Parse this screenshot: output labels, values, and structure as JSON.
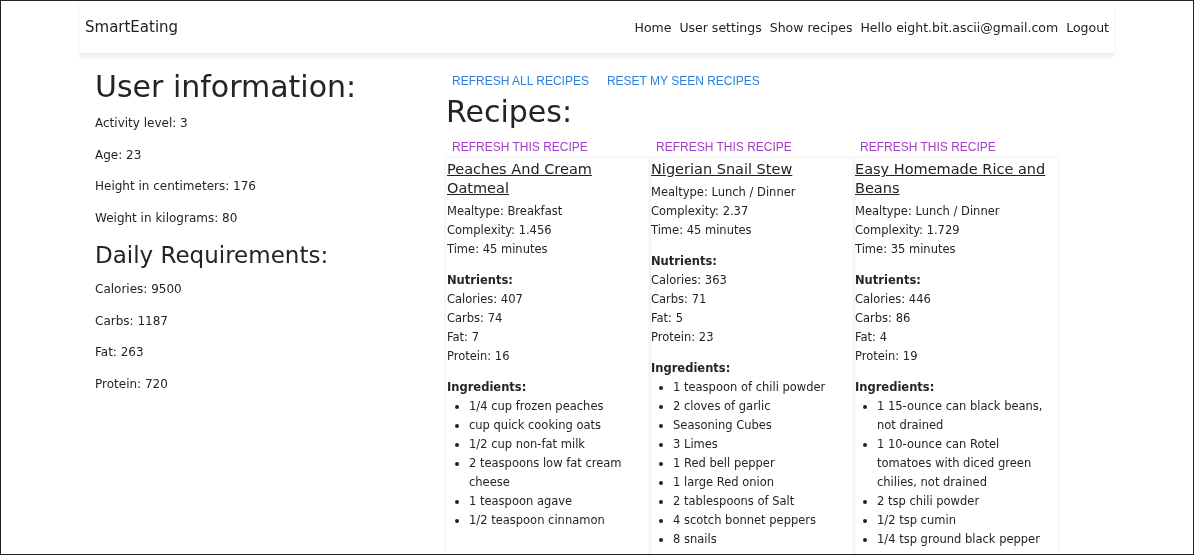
{
  "navbar": {
    "brand": "SmartEating",
    "links": [
      "Home",
      "User settings",
      "Show recipes",
      "Hello eight.bit.ascii@gmail.com",
      "Logout"
    ]
  },
  "user_information": {
    "title": "User information:",
    "fields": [
      "Activity level: 3",
      "Age: 23",
      "Height in centimeters: 176",
      "Weight in kilograms: 80"
    ]
  },
  "daily_requirements": {
    "title": "Daily Requirements:",
    "fields": [
      "Calories: 9500",
      "Carbs: 1187",
      "Fat: 263",
      "Protein: 720"
    ]
  },
  "actions": [
    "REFRESH ALL RECIPES",
    "RESET MY SEEN RECIPES"
  ],
  "recipes_title": "Recipes:",
  "recipes": [
    {
      "refresh": "REFRESH THIS RECIPE",
      "name": "Peaches And Cream Oatmeal",
      "details": [
        "Mealtype: Breakfast",
        "Complexity: 1.456",
        "Time: 45 minutes"
      ],
      "nutrients_title": "Nutrients:",
      "nutrients": [
        "Calories: 407",
        "Carbs: 74",
        "Fat: 7",
        "Protein: 16"
      ],
      "ingredients_title": "Ingredients:",
      "ingredients": [
        "1/4 cup frozen peaches",
        "cup quick cooking oats",
        "1/2 cup non-fat milk",
        "2 teaspoons low fat cream cheese",
        "1 teaspoon agave",
        "1/2 teaspoon cinnamon"
      ]
    },
    {
      "refresh": "REFRESH THIS RECIPE",
      "name": "Nigerian Snail Stew",
      "details": [
        "Mealtype: Lunch / Dinner",
        "Complexity: 2.37",
        "Time: 45 minutes"
      ],
      "nutrients_title": "Nutrients:",
      "nutrients": [
        "Calories: 363",
        "Carbs: 71",
        "Fat: 5",
        "Protein: 23"
      ],
      "ingredients_title": "Ingredients:",
      "ingredients": [
        "1 teaspoon of chili powder",
        "2 cloves of garlic",
        "Seasoning Cubes",
        "3 Limes",
        "1 Red bell pepper",
        "1 large Red onion",
        "2 tablespoons of Salt",
        "4 scotch bonnet peppers",
        "8 snails"
      ]
    },
    {
      "refresh": "REFRESH THIS RECIPE",
      "name": "Easy Homemade Rice and Beans",
      "details": [
        "Mealtype: Lunch / Dinner",
        "Complexity: 1.729",
        "Time: 35 minutes"
      ],
      "nutrients_title": "Nutrients:",
      "nutrients": [
        "Calories: 446",
        "Carbs: 86",
        "Fat: 4",
        "Protein: 19"
      ],
      "ingredients_title": "Ingredients:",
      "ingredients": [
        "1 15-ounce can black beans, not drained",
        "1 10-ounce can Rotel tomatoes with diced green chilies, not drained",
        "2 tsp chili powder",
        "1/2 tsp cumin",
        "1/4 tsp ground black pepper"
      ]
    }
  ]
}
